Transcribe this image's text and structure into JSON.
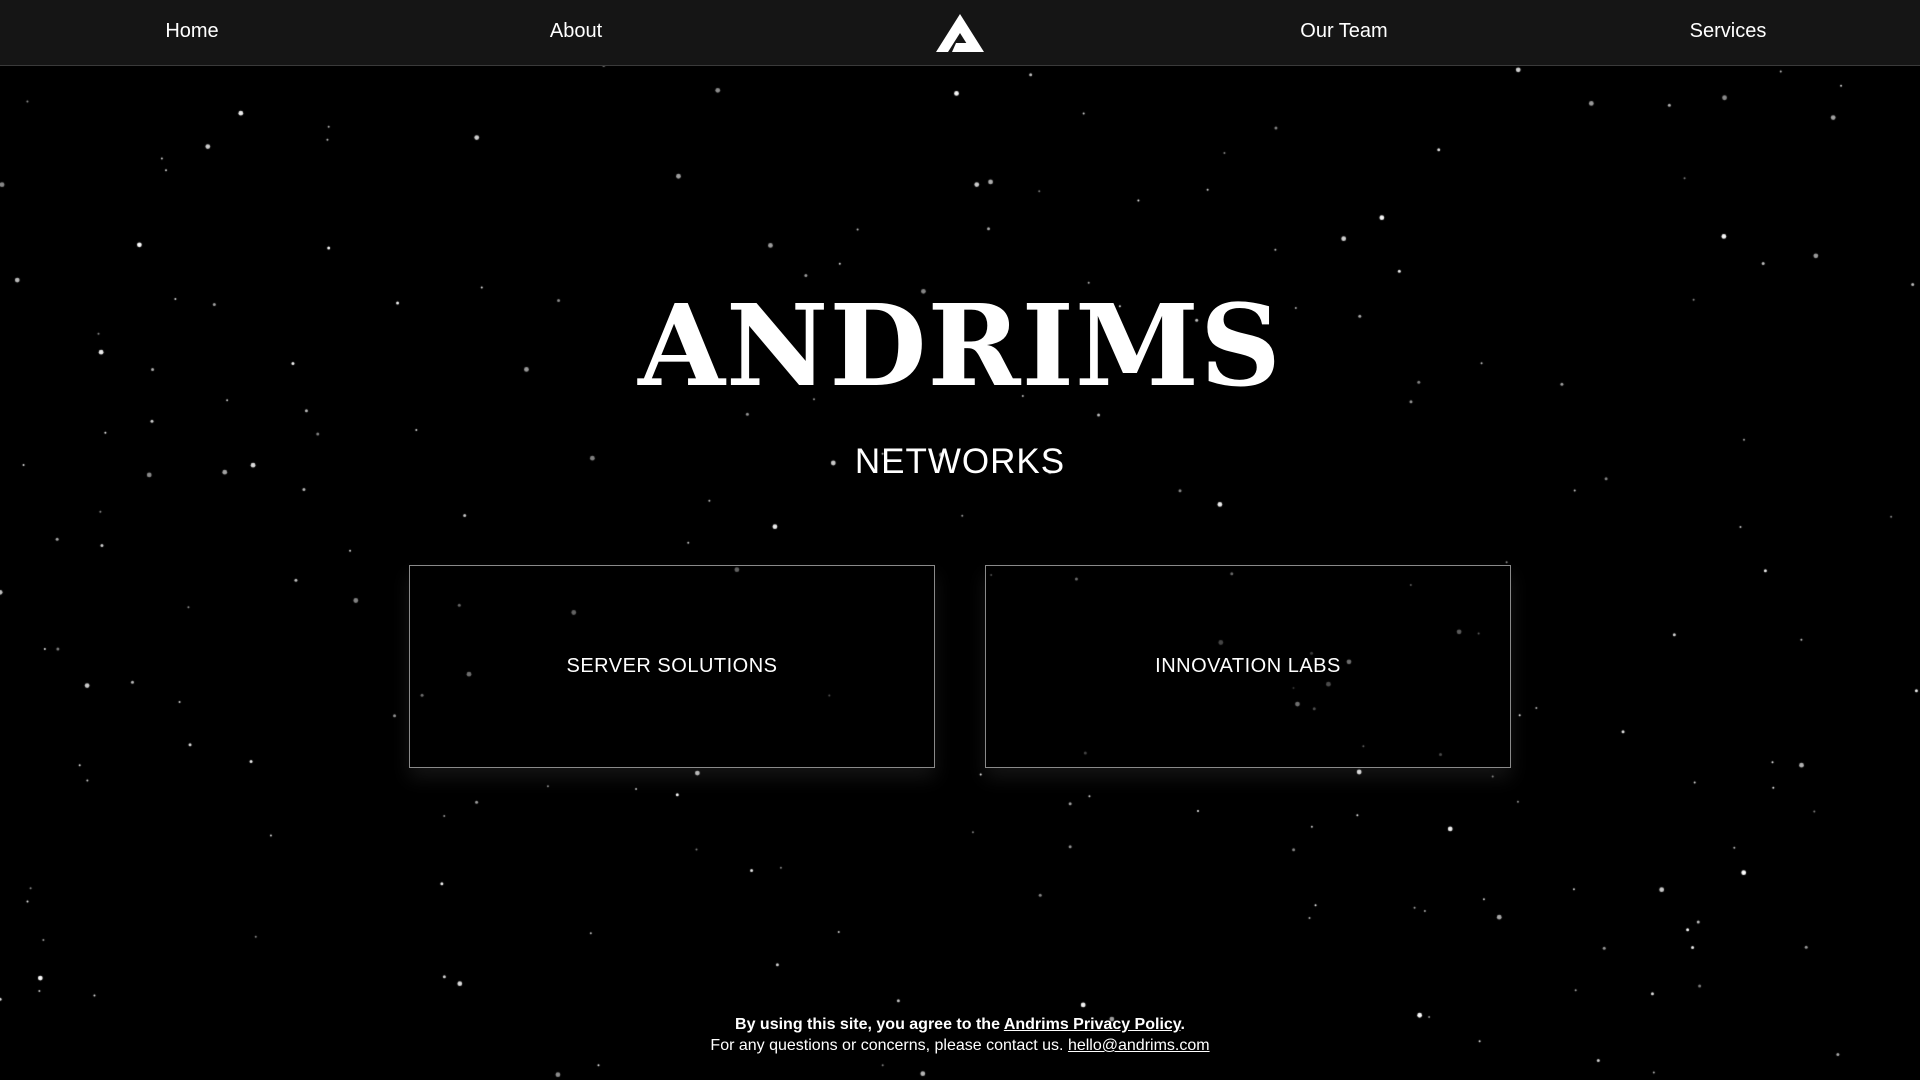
{
  "nav": {
    "home": "Home",
    "about": "About",
    "our_team": "Our Team",
    "services": "Services",
    "logo_icon": "andrims-triangle-logo"
  },
  "hero": {
    "title": "ANDRIMS",
    "subtitle": "NETWORKS"
  },
  "cards": {
    "server_solutions": "SERVER SOLUTIONS",
    "innovation_labs": "INNOVATION LABS"
  },
  "footer": {
    "agree_text": "By using this site, you agree to the ",
    "privacy_link": "Andrims Privacy Policy",
    "agree_end": ".",
    "contact_text": "For any questions or concerns, please contact us. ",
    "email": "hello@andrims.com"
  },
  "colors": {
    "background": "#000000",
    "nav_background": "#151515",
    "text": "#ffffff",
    "card_border": "#8a8a8a"
  }
}
